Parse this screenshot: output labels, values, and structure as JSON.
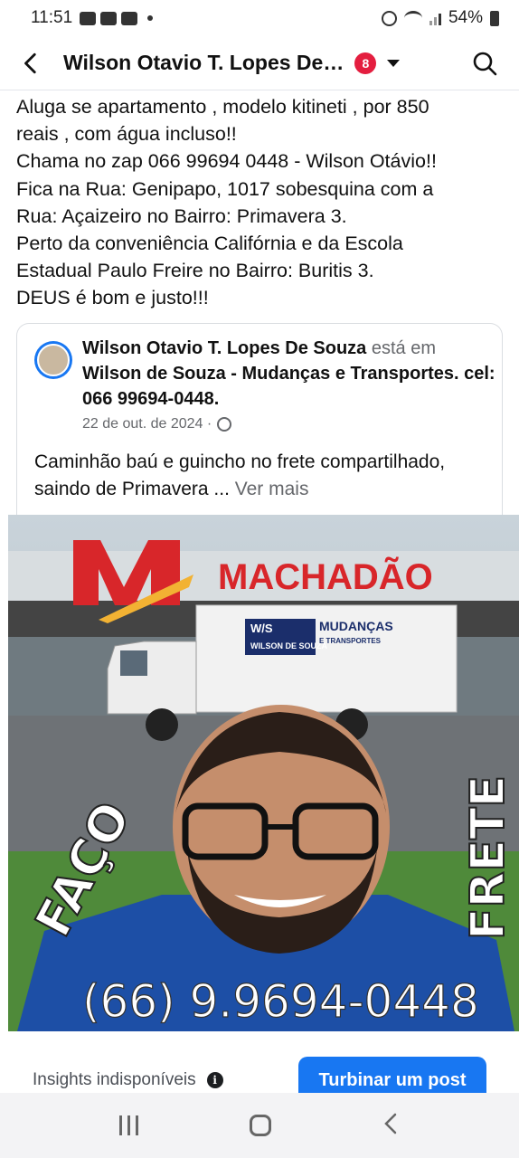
{
  "status_bar": {
    "time": "11:51",
    "battery": "54%"
  },
  "header": {
    "title": "Wilson Otavio T. Lopes De…",
    "badge_count": "8"
  },
  "post": {
    "lines": [
      "Aluga se apartamento , modelo kitineti , por 850",
      "reais , com água incluso!!",
      "Chama no zap 066 99694 0448 - Wilson Otávio!!",
      "Fica na Rua: Genipapo, 1017 sobesquina com a",
      "Rua: Açaizeiro no Bairro: Primavera 3.",
      "Perto da conveniência Califórnia e da Escola",
      "Estadual Paulo Freire no Bairro: Buritis 3.",
      "DEUS é bom e justo!!!"
    ]
  },
  "shared": {
    "author": "Wilson Otavio T. Lopes De Souza",
    "verb": " está em ",
    "place": "Wilson de Souza - Mudanças e Transportes. cel: 066 99694-0448.",
    "date": "22 de out. de 2024 ·",
    "body": "Caminhão baú e guincho no frete compartilhado, saindo de Primavera ...",
    "see_more": "Ver mais"
  },
  "photo": {
    "store_sign": "MACHADÃO",
    "truck_logo": "W/S",
    "truck_logo_name": "WILSON DE SOUZA",
    "truck_text": "MUDANÇAS",
    "truck_subtext": "E TRANSPORTES",
    "left_word": "FAÇO",
    "right_word": "FRETE",
    "phone": "(66) 9.9694-0448"
  },
  "footer": {
    "insights": "Insights indisponíveis",
    "boost": "Turbinar um post"
  },
  "colors": {
    "accent": "#1877f2",
    "badge": "#e41e3f"
  }
}
